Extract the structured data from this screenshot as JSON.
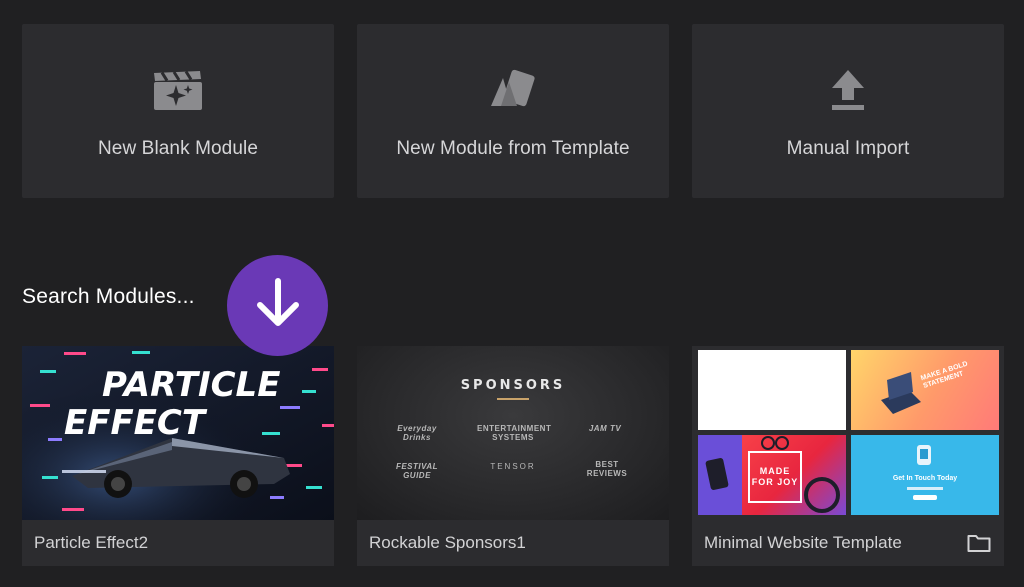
{
  "actions": {
    "blank_label": "New Blank Module",
    "template_label": "New Module from Template",
    "import_label": "Manual Import"
  },
  "search": {
    "title": "Search Modules..."
  },
  "modules": [
    {
      "name": "Particle Effect2",
      "thumb_line1": "PARTICLE",
      "thumb_line2": "EFFECT"
    },
    {
      "name": "Rockable Sponsors1",
      "thumb_title": "SPONSORS",
      "logos": [
        "Everyday Drinks",
        "ENTERTAINMENT SYSTEMS",
        "JAM TV",
        "FESTIVAL GUIDE",
        "TENSOR",
        "BEST REVIEWS"
      ]
    },
    {
      "name": "Minimal Website Template",
      "tile_joy": "MADE FOR JOY",
      "tile_bold": "MAKE A BOLD STATEMENT",
      "tile_touch": "Get In Touch Today"
    }
  ],
  "colors": {
    "background": "#202022",
    "card": "#2c2c2f",
    "badge": "#6a39b6"
  },
  "icons": [
    "clapperboard-sparkle-icon",
    "template-cards-icon",
    "upload-icon",
    "arrow-down-icon",
    "folder-icon"
  ]
}
